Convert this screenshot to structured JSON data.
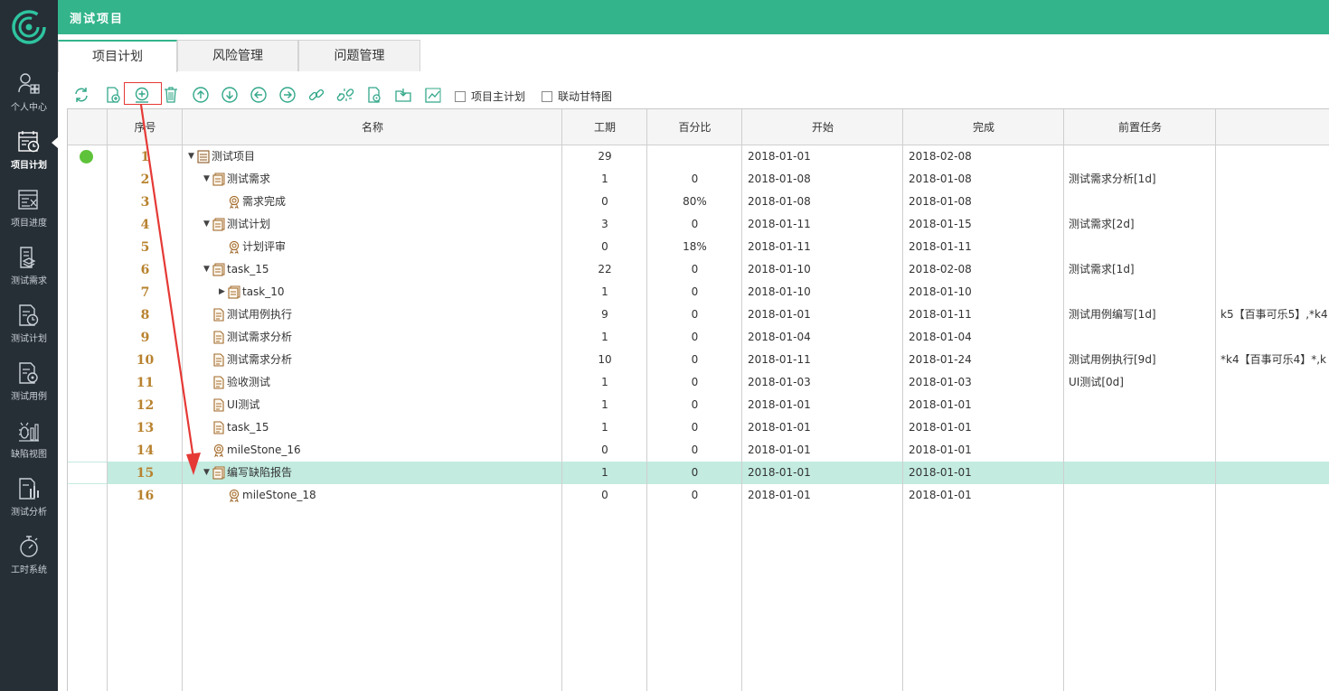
{
  "app": {
    "title": "测试项目"
  },
  "sidebar": {
    "items": [
      {
        "label": "个人中心",
        "icon": "user-grid-icon",
        "active": false
      },
      {
        "label": "项目计划",
        "icon": "calendar-clock-icon",
        "active": true
      },
      {
        "label": "项目进度",
        "icon": "progress-chart-icon",
        "active": false
      },
      {
        "label": "测试需求",
        "icon": "layers-icon",
        "active": false
      },
      {
        "label": "测试计划",
        "icon": "doc-clock-icon",
        "active": false
      },
      {
        "label": "测试用例",
        "icon": "doc-gear-icon",
        "active": false
      },
      {
        "label": "缺陷视图",
        "icon": "bug-bar-icon",
        "active": false
      },
      {
        "label": "测试分析",
        "icon": "analysis-chart-icon",
        "active": false
      },
      {
        "label": "工时系统",
        "icon": "stopwatch-icon",
        "active": false
      }
    ]
  },
  "tabs": [
    {
      "label": "项目计划",
      "active": true
    },
    {
      "label": "风险管理",
      "active": false
    },
    {
      "label": "问题管理",
      "active": false
    }
  ],
  "toolbar": {
    "icons": [
      "refresh-icon",
      "add-task-icon",
      "add-subtask-icon",
      "delete-icon",
      "move-up-icon",
      "move-down-icon",
      "outdent-icon",
      "indent-icon",
      "link-icon",
      "unlink-icon",
      "task-settings-icon",
      "import-icon",
      "chart-icon"
    ],
    "master_plan_label": "项目主计划",
    "link_gantt_label": "联动甘特图",
    "master_plan_checked": false,
    "link_gantt_checked": false
  },
  "grid": {
    "columns": [
      "序号",
      "名称",
      "工期",
      "百分比",
      "开始",
      "完成",
      "前置任务",
      ""
    ],
    "rows": [
      {
        "seq": "1",
        "name": "测试项目",
        "level": 0,
        "toggle": "▼",
        "type": "project",
        "duration": "29",
        "percent": "",
        "start": "2018-01-01",
        "finish": "2018-02-08",
        "predecessor": "",
        "extra": "",
        "status_dot": true
      },
      {
        "seq": "2",
        "name": "测试需求",
        "level": 1,
        "toggle": "▼",
        "type": "summary",
        "duration": "1",
        "percent": "0",
        "start": "2018-01-08",
        "finish": "2018-01-08",
        "predecessor": "测试需求分析[1d]",
        "extra": ""
      },
      {
        "seq": "3",
        "name": "需求完成",
        "level": 2,
        "toggle": "",
        "type": "milestone",
        "duration": "0",
        "percent": "80%",
        "start": "2018-01-08",
        "finish": "2018-01-08",
        "predecessor": "",
        "extra": ""
      },
      {
        "seq": "4",
        "name": "测试计划",
        "level": 1,
        "toggle": "▼",
        "type": "summary",
        "duration": "3",
        "percent": "0",
        "start": "2018-01-11",
        "finish": "2018-01-15",
        "predecessor": "测试需求[2d]",
        "extra": ""
      },
      {
        "seq": "5",
        "name": "计划评审",
        "level": 2,
        "toggle": "",
        "type": "milestone",
        "duration": "0",
        "percent": "18%",
        "start": "2018-01-11",
        "finish": "2018-01-11",
        "predecessor": "",
        "extra": ""
      },
      {
        "seq": "6",
        "name": "task_15",
        "level": 1,
        "toggle": "▼",
        "type": "summary",
        "duration": "22",
        "percent": "0",
        "start": "2018-01-10",
        "finish": "2018-02-08",
        "predecessor": "测试需求[1d]",
        "extra": ""
      },
      {
        "seq": "7",
        "name": "task_10",
        "level": 2,
        "toggle": "▶",
        "type": "summary",
        "duration": "1",
        "percent": "0",
        "start": "2018-01-10",
        "finish": "2018-01-10",
        "predecessor": "",
        "extra": ""
      },
      {
        "seq": "8",
        "name": "测试用例执行",
        "level": 1,
        "toggle": "",
        "type": "task",
        "duration": "9",
        "percent": "0",
        "start": "2018-01-01",
        "finish": "2018-01-11",
        "predecessor": "测试用例编写[1d]",
        "extra": "k5【百事可乐5】,*k4"
      },
      {
        "seq": "9",
        "name": "测试需求分析",
        "level": 1,
        "toggle": "",
        "type": "task",
        "duration": "1",
        "percent": "0",
        "start": "2018-01-04",
        "finish": "2018-01-04",
        "predecessor": "",
        "extra": ""
      },
      {
        "seq": "10",
        "name": "测试需求分析",
        "level": 1,
        "toggle": "",
        "type": "task",
        "duration": "10",
        "percent": "0",
        "start": "2018-01-11",
        "finish": "2018-01-24",
        "predecessor": "测试用例执行[9d]",
        "extra": "*k4【百事可乐4】*,k"
      },
      {
        "seq": "11",
        "name": "验收测试",
        "level": 1,
        "toggle": "",
        "type": "task",
        "duration": "1",
        "percent": "0",
        "start": "2018-01-03",
        "finish": "2018-01-03",
        "predecessor": "UI测试[0d]",
        "extra": ""
      },
      {
        "seq": "12",
        "name": "UI测试",
        "level": 1,
        "toggle": "",
        "type": "task",
        "duration": "1",
        "percent": "0",
        "start": "2018-01-01",
        "finish": "2018-01-01",
        "predecessor": "",
        "extra": ""
      },
      {
        "seq": "13",
        "name": "task_15",
        "level": 1,
        "toggle": "",
        "type": "task",
        "duration": "1",
        "percent": "0",
        "start": "2018-01-01",
        "finish": "2018-01-01",
        "predecessor": "",
        "extra": ""
      },
      {
        "seq": "14",
        "name": "mileStone_16",
        "level": 1,
        "toggle": "",
        "type": "milestone",
        "duration": "0",
        "percent": "0",
        "start": "2018-01-01",
        "finish": "2018-01-01",
        "predecessor": "",
        "extra": ""
      },
      {
        "seq": "15",
        "name": "编写缺陷报告",
        "level": 1,
        "toggle": "▼",
        "type": "summary",
        "duration": "1",
        "percent": "0",
        "start": "2018-01-01",
        "finish": "2018-01-01",
        "predecessor": "",
        "extra": "",
        "selected": true
      },
      {
        "seq": "16",
        "name": "mileStone_18",
        "level": 2,
        "toggle": "",
        "type": "milestone",
        "duration": "0",
        "percent": "0",
        "start": "2018-01-01",
        "finish": "2018-01-01",
        "predecessor": "",
        "extra": ""
      }
    ]
  },
  "colors": {
    "accent": "#33b48b",
    "sidebar": "#262e36",
    "selected_row": "#c3ebe0",
    "seq_text": "#b8822e",
    "status_dot": "#5ec33a",
    "annotation": "#e53935"
  }
}
